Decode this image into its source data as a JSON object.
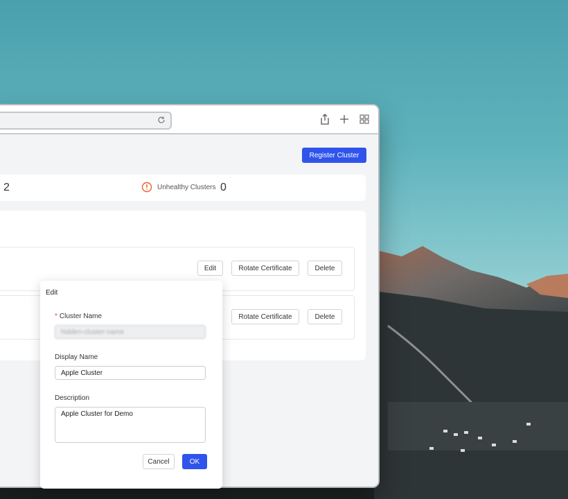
{
  "content": {
    "register_label": "Register Cluster",
    "stats": {
      "left_value": "2",
      "unhealthy_label": "Unhealthy Clusters",
      "unhealthy_value": "0"
    },
    "rows": [
      {
        "edit_label": "Edit",
        "rotate_label": "Rotate Certificate",
        "delete_label": "Delete"
      },
      {
        "rotate_label": "Rotate Certificate",
        "delete_label": "Delete"
      }
    ]
  },
  "dialog": {
    "title": "Edit",
    "cluster_name_label": "Cluster Name",
    "required_mark": "*",
    "cluster_name_value": "hidden-cluster-name",
    "display_name_label": "Display Name",
    "display_name_value": "Apple Cluster",
    "description_label": "Description",
    "description_value": "Apple Cluster for Demo",
    "cancel_label": "Cancel",
    "ok_label": "OK"
  },
  "icons": {
    "reload": "reload-icon",
    "share": "share-icon",
    "add_tab": "plus-icon",
    "tab_overview": "grid-icon",
    "warning": "warning-circle-icon"
  },
  "colors": {
    "accent": "#2f54eb",
    "warning": "#e8612c",
    "required": "#e5484d"
  }
}
